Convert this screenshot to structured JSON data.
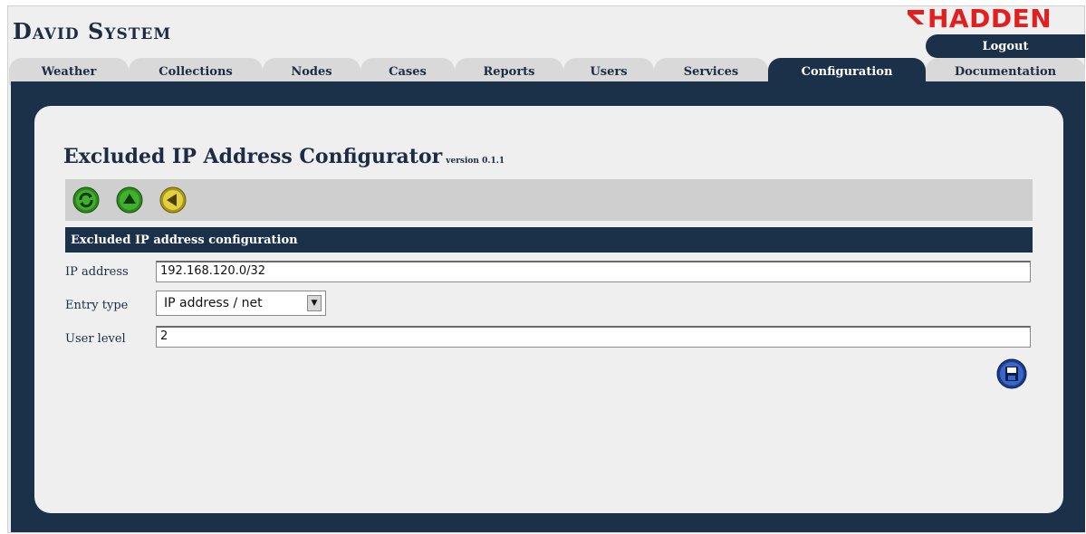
{
  "header": {
    "title": "David System",
    "logo_text": "HADDEN",
    "logout_label": "Logout"
  },
  "tabs": [
    {
      "label": "Weather"
    },
    {
      "label": "Collections"
    },
    {
      "label": "Nodes"
    },
    {
      "label": "Cases"
    },
    {
      "label": "Reports"
    },
    {
      "label": "Users"
    },
    {
      "label": "Services"
    },
    {
      "label": "Configuration",
      "active": true
    },
    {
      "label": "Documentation"
    }
  ],
  "page": {
    "title": "Excluded IP Address Configurator",
    "version": "version 0.1.1"
  },
  "toolbar": {
    "icons": [
      "refresh-icon",
      "up-icon",
      "back-icon"
    ]
  },
  "form": {
    "section_title": "Excluded IP address configuration",
    "ip_label": "IP address",
    "ip_value": "192.168.120.0/32",
    "entry_type_label": "Entry type",
    "entry_type_value": "IP address / net",
    "user_level_label": "User level",
    "user_level_value": "2"
  },
  "colors": {
    "navy": "#1b3049",
    "logo_red": "#e02020",
    "panel": "#efefef"
  }
}
